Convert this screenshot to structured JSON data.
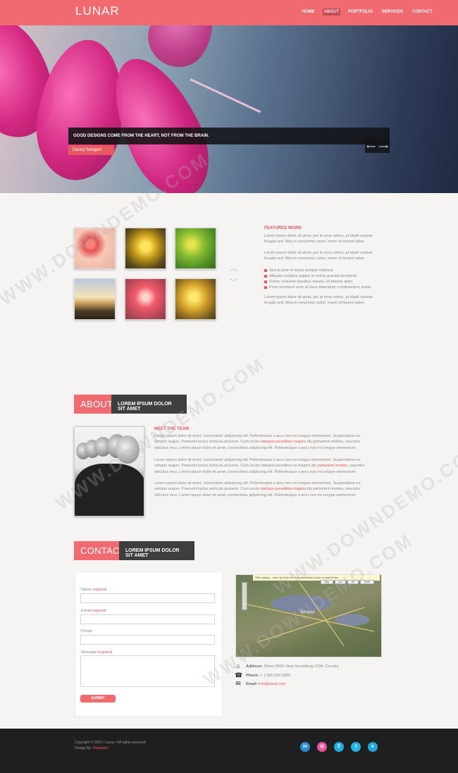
{
  "header": {
    "logo": "LUNAR",
    "nav": [
      "HOME",
      "ABOUT",
      "PORTFOLIO",
      "SERVICES",
      "CONTACT"
    ]
  },
  "hero": {
    "quote": "GOOD DESIGNS COME FROM THE HEART, NOT FROM THE BRAIN.",
    "author": "Danny Sangers",
    "prev_icon": "arrow-left-icon",
    "next_icon": "arrow-right-icon"
  },
  "featured": {
    "title": "FEATURED WORK",
    "para1": "Lorem ipsum dolor sit amet, per te eros ceteru, at idaeli causae feugiat sed. Mea in nonummy ceteri, hoem id tiunem labre.",
    "para2": "Lorem ipsum dolor sit amet, per te eros ceteru, at idaeli causae feugiat sed. Mea in nonummy ceteri, hoem id tiunem labre.",
    "list": [
      "Sed at ante et turpis semper eleifend.",
      "Aliquam sodales sapien in metus gravida hendrerit.",
      "Donec molestie faucibus mauris, id lobortis diam.",
      "Proin hendrerit nunc at risus bibendum condimentum sodal."
    ],
    "para3": "Lorem ipsum dolor sit amet, per te eros ceteru, at idaeli causae feugiat sed. Mea in nonummy ceteri, hoem id tiunem labre."
  },
  "about": {
    "heading": "ABOUT",
    "subheading": "LOREM IPSUM DOLOR SIT AMET",
    "meet_title": "MEET THE TEAM",
    "p1_a": "Lorem ipsum dolor sit amet, consectetur adipiscing elit. Pellentesque a arcu non mi congue elementum. Suspendisse eu semper augue. Praesent luctus vehicula posuere. Cum sociis ",
    "p1_link1": "natoque penatibus magnis",
    "p1_b": " dis parturient montes, nascetur ridiculus mus. Lorem ipsum dolor sit amet, consectetur adipiscing elit. Pellentesque a arcu non mi congue elementum.",
    "p2_a": "Lorem ipsum dolor sit amet, consectetur adipiscing elit. Pellentesque a arcu non mi congue elementum. Suspendisse eu semper augue. Praesent luctus vehicula posuere. Cum sociis natoque penatibus et magnis dis ",
    "p2_link1": "parturient montes",
    "p2_b": ", nascetur ridiculus mus. Lorem ipsum dolor sit amet, consectetur adipiscing elit. Pellentesque a arcu non mi congue elementum.",
    "p3_a": "Lorem ipsum dolor sit amet, consectetur adipiscing elit. Pellentesque a arcu non mi congue elementum. Suspendisse eu semper augue. Praesent luctus vehicula posuere. Cum sociis ",
    "p3_link1": "natoque penatibus magnis",
    "p3_b": " dis parturient montes, nascetur ridiculus mus. Lorem ipsum dolor sit amet, consectetur adipiscing elit. Pellentesque a arcu non mi congue elementum."
  },
  "contact": {
    "heading": "CONTACT",
    "subheading": "LOREM IPSUM DOLOR SIT AMET",
    "form": {
      "name_label": "Name",
      "email_label": "Email",
      "phone_label": "Phone",
      "message_label": "Message",
      "required": "required",
      "submit": "SUBMIT"
    },
    "map": {
      "bar_text": "Still loading... learn more in the documentation guide or search tips",
      "btn_map": "Map",
      "btn_sat": "Sat",
      "btn_ter": "Ter",
      "btn_earth": "Earth",
      "city": "Beograd"
    },
    "info": {
      "address_label": "Address:",
      "address_value": "Street 0000, New Something 1234, Country",
      "phone_label": "Phone:",
      "phone_value": "+ 1 000 000 0000",
      "email_label": "Email:",
      "email_value": "info@lunar.com"
    }
  },
  "footer": {
    "copyright": "Copyright © 2012 • Lunar • All rights reserved",
    "design_by_label": "Design By:",
    "design_by_value": "Pixelartist",
    "social": [
      {
        "name": "linkedin-icon",
        "glyph": "in",
        "color": "#2a8bd1"
      },
      {
        "name": "dribbble-icon",
        "glyph": "◎",
        "color": "#e75598"
      },
      {
        "name": "skype-icon",
        "glyph": "S",
        "color": "#1eaee3"
      },
      {
        "name": "twitter-icon",
        "glyph": "t",
        "color": "#26b2e8"
      },
      {
        "name": "vimeo-icon",
        "glyph": "v",
        "color": "#1fa6d6"
      }
    ]
  },
  "watermark": "WWW.DOWNDEMO.COM",
  "colors": {
    "accent": "#f06a6f",
    "dark": "#3e3e3e",
    "footer": "#1f1f1f"
  }
}
